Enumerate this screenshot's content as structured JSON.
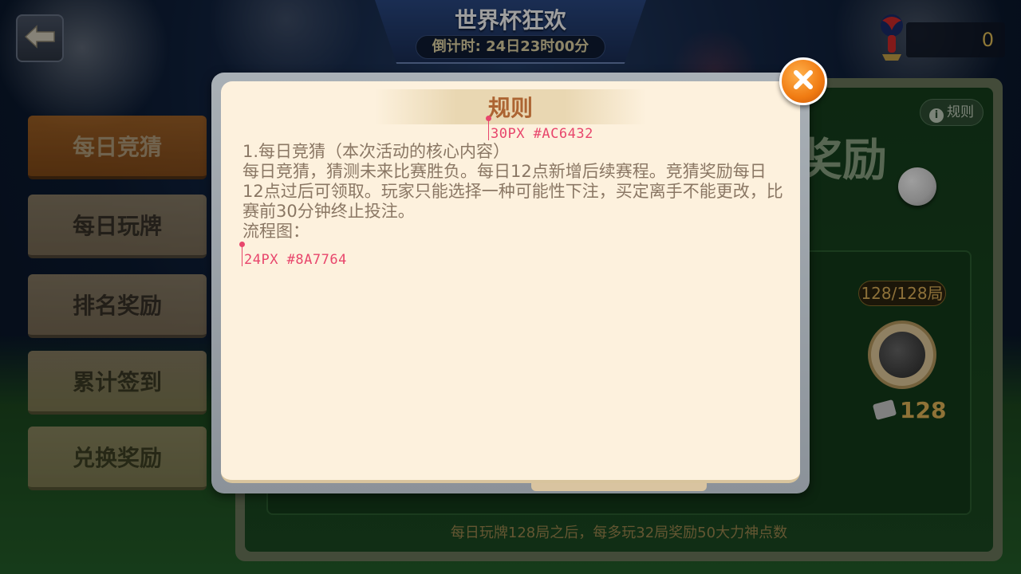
{
  "header": {
    "title": "世界杯狂欢",
    "countdown": "倒计时: 24日23时00分",
    "coins": "0"
  },
  "menu": {
    "items": [
      {
        "label": "每日竞猜",
        "active": true
      },
      {
        "label": "每日玩牌",
        "active": false
      },
      {
        "label": "排名奖励",
        "active": false
      },
      {
        "label": "累计签到",
        "active": false
      },
      {
        "label": "兑换奖励",
        "active": false
      }
    ]
  },
  "panel": {
    "rule_button": "规则",
    "rule_icon": "i",
    "title_partial": "奖励",
    "progress": "128/128局",
    "reward_amount": "128",
    "footer": "每日玩牌128局之后，每多玩32局奖励50大力神点数"
  },
  "modal": {
    "title": "规则",
    "lines": [
      "1.每日竞猜（本次活动的核心内容）",
      "每日竞猜，猜测未来比赛胜负。每日12点新增后续赛程。竞猜奖励每日12点过后可领取。玩家只能选择一种可能性下注，买定离手不能更改，比赛前30分钟终止投注。",
      "流程图："
    ],
    "annotation_title": "30PX #AC6432",
    "annotation_body": "24PX #8A7764"
  },
  "colors": {
    "title_color": "#AC6432",
    "body_color": "#8A7764",
    "annotation": "#E8466C",
    "accent_orange": "#F07B12"
  },
  "icons": {
    "back": "back-arrow-icon",
    "close": "close-icon",
    "logo": "world-cup-logo-icon",
    "ball": "soccer-ball-icon",
    "chip": "poker-chip-icon"
  }
}
